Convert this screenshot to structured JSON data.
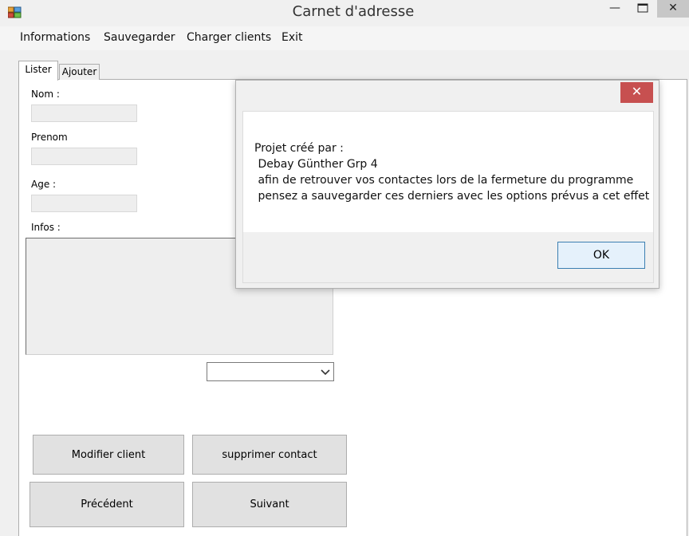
{
  "window": {
    "title": "Carnet d'adresse",
    "minimize_symbol": "—",
    "maximize_symbol": "☐",
    "close_symbol": "✕"
  },
  "menu": {
    "items": [
      "Informations",
      "Sauvegarder",
      "Charger clients",
      "Exit"
    ]
  },
  "tabs": [
    {
      "label": "Lister",
      "selected": true
    },
    {
      "label": "Ajouter",
      "selected": false
    }
  ],
  "form": {
    "nom_label": "Nom :",
    "prenom_label": "Prenom",
    "age_label": "Age :",
    "infos_label": "Infos :",
    "nom_value": "",
    "prenom_value": "",
    "age_value": "",
    "infos_value": "",
    "combo_value": ""
  },
  "buttons": {
    "modify": "Modifier client",
    "delete": "supprimer contact",
    "previous": "Précédent",
    "next": "Suivant"
  },
  "dialog": {
    "close_symbol": "✕",
    "lines": [
      "Projet créé par :",
      " Debay Günther Grp 4",
      " afin de retrouver vos contactes lors de la fermeture du programme",
      " pensez a sauvegarder ces derniers avec les options prévus a cet effet"
    ],
    "ok_label": "OK"
  },
  "colors": {
    "dialog_close_bg": "#c75050",
    "ok_border": "#3c7fb1"
  }
}
